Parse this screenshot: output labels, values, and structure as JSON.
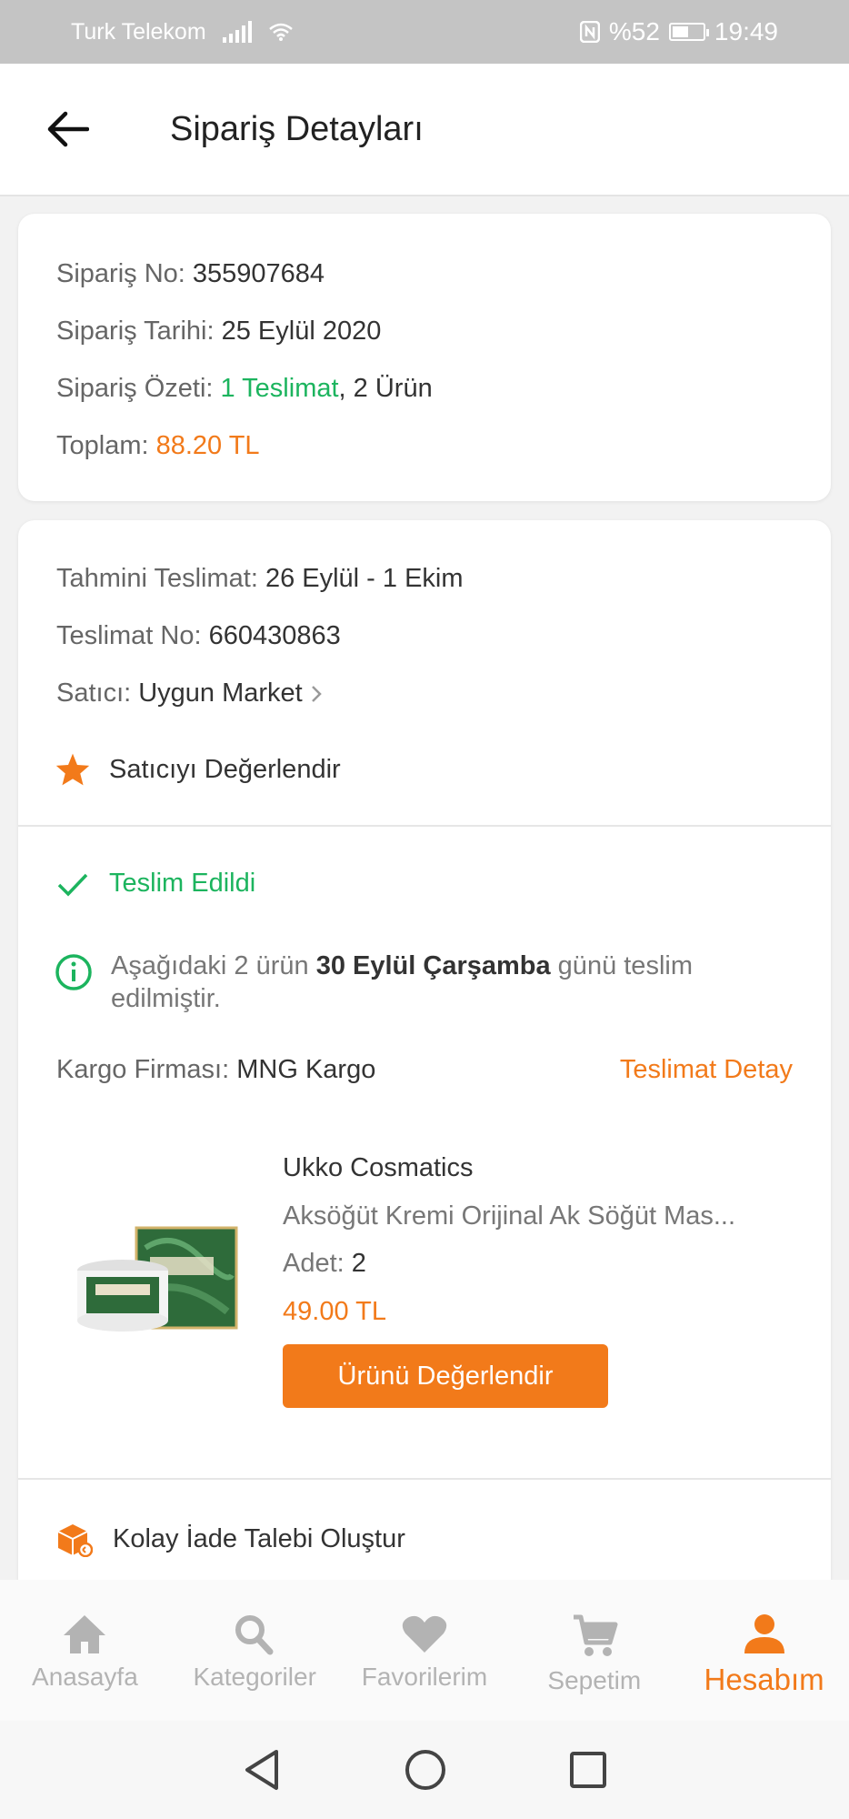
{
  "status_bar": {
    "carrier": "Turk Telekom",
    "battery": "%52",
    "time": "19:49"
  },
  "header": {
    "title": "Sipariş Detayları"
  },
  "order_summary": {
    "order_no_label": "Sipariş No:",
    "order_no": "355907684",
    "order_date_label": "Sipariş Tarihi:",
    "order_date": "25 Eylül 2020",
    "summary_label": "Sipariş Özeti:",
    "summary_delivery": "1 Teslimat",
    "summary_items": ", 2 Ürün",
    "total_label": "Toplam:",
    "total": "88.20 TL"
  },
  "delivery": {
    "estimated_label": "Tahmini Teslimat:",
    "estimated": "26 Eylül - 1 Ekim",
    "delivery_no_label": "Teslimat No:",
    "delivery_no": "660430863",
    "seller_label": "Satıcı:",
    "seller": "Uygun Market",
    "rate_seller": "Satıcıyı Değerlendir",
    "status": "Teslim Edildi",
    "info_pre": "Aşağıdaki 2 ürün ",
    "info_bold": "30 Eylül Çarşamba",
    "info_post": " günü teslim edilmiştir.",
    "cargo_label": "Kargo Firması:",
    "cargo": "MNG Kargo",
    "delivery_detail_link": "Teslimat Detay"
  },
  "product": {
    "brand": "Ukko Cosmatics",
    "name": "Aksöğüt Kremi Orijinal Ak Söğüt Mas...",
    "qty_label": "Adet:",
    "qty": "2",
    "price": "49.00 TL",
    "rate_button": "Ürünü Değerlendir"
  },
  "return": {
    "label": "Kolay İade Talebi Oluştur"
  },
  "tabs": [
    {
      "label": "Anasayfa",
      "icon": "home-icon"
    },
    {
      "label": "Kategoriler",
      "icon": "search-icon"
    },
    {
      "label": "Favorilerim",
      "icon": "heart-icon"
    },
    {
      "label": "Sepetim",
      "icon": "cart-icon"
    },
    {
      "label": "Hesabım",
      "icon": "user-icon",
      "active": true
    }
  ],
  "colors": {
    "accent": "#f27a1a",
    "success": "#1cb45e"
  }
}
